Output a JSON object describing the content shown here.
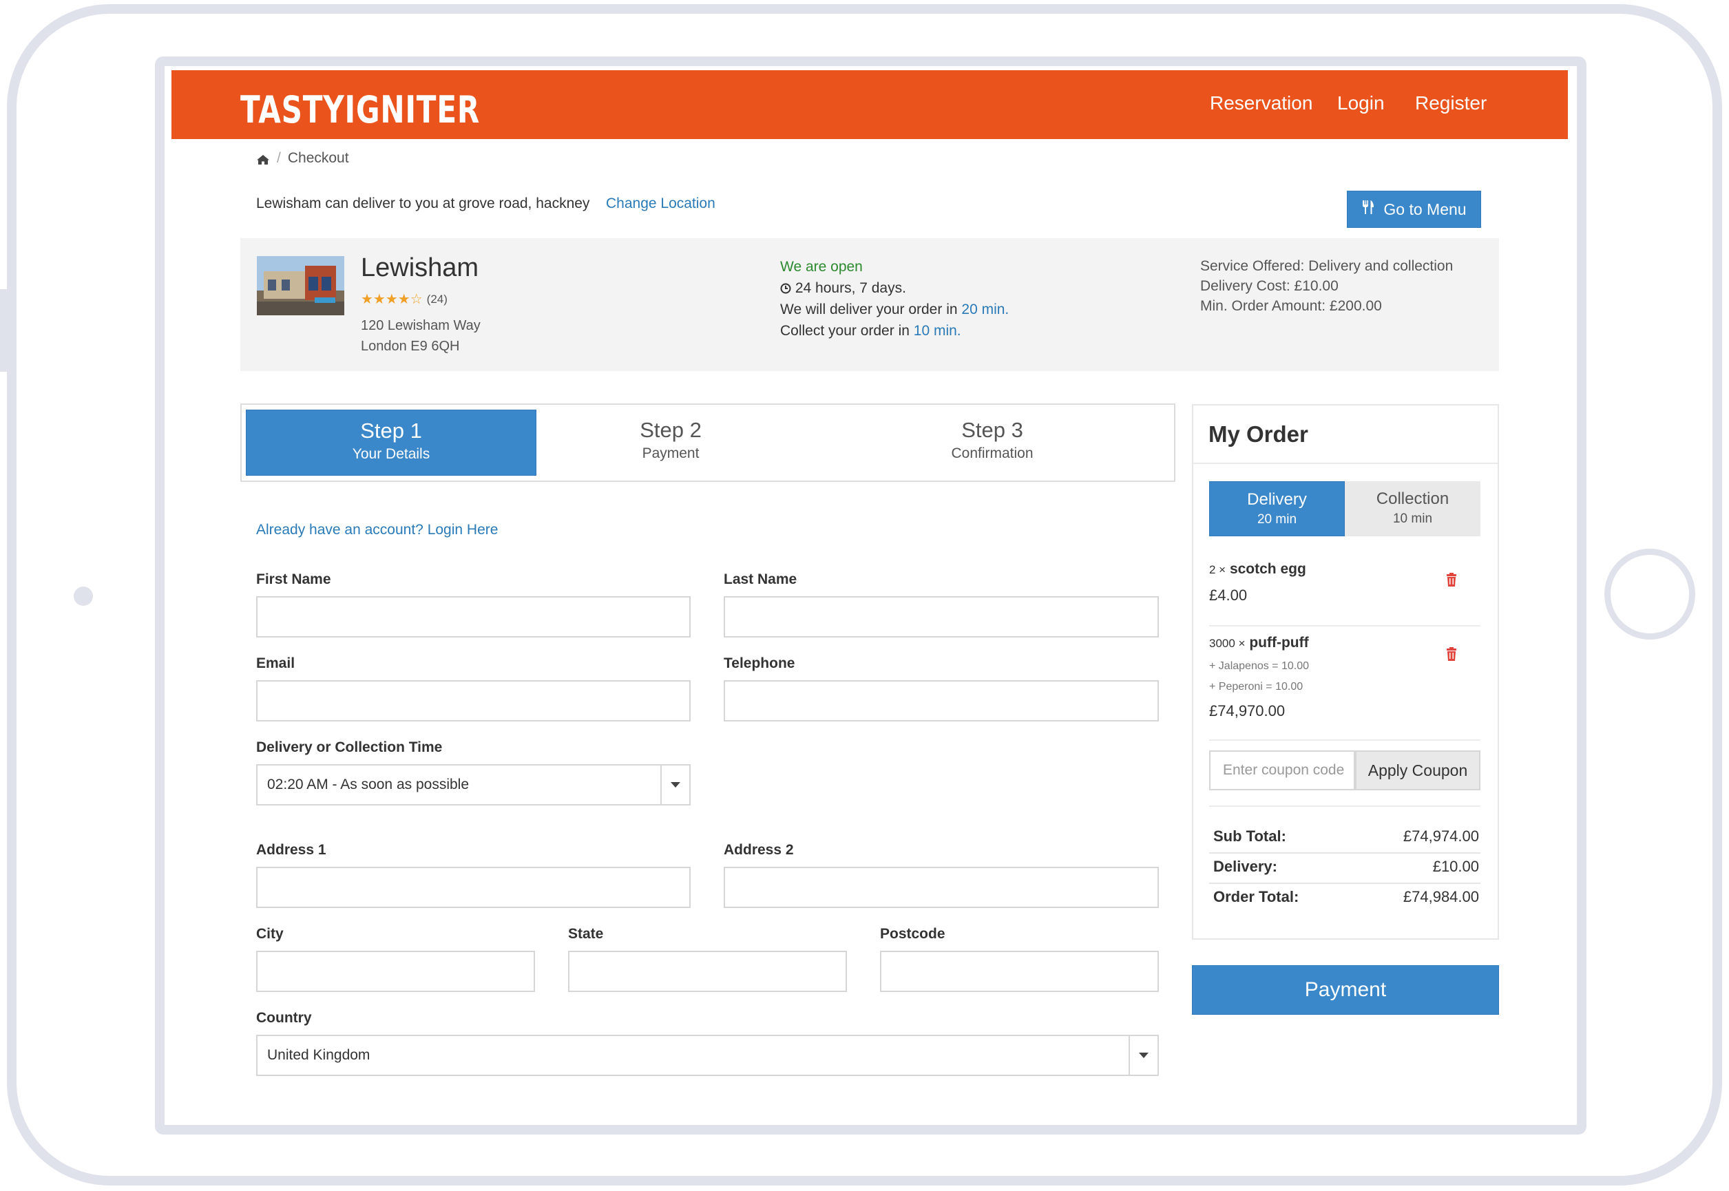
{
  "colors": {
    "brand": "#eb531c",
    "primary": "#3a87c9",
    "link": "#2a7ab8",
    "open": "#2c8a2f"
  },
  "header": {
    "logo": "TASTYIGNITER",
    "nav": {
      "reservation": "Reservation",
      "login": "Login",
      "register": "Register"
    }
  },
  "breadcrumb": {
    "home_icon": "home-icon",
    "current": "Checkout"
  },
  "location_bar": {
    "deliver_text": "Lewisham can deliver to you at grove road, hackney",
    "change_location": "Change Location",
    "go_to_menu": "Go to Menu"
  },
  "location": {
    "name": "Lewisham",
    "stars": "★★★★☆",
    "rating_value": 3.5,
    "reviews": "(24)",
    "address_line1": "120 Lewisham Way",
    "address_line2": "London E9 6QH",
    "status": "We are open",
    "hours": "24 hours, 7 days.",
    "delivery_prefix": "We will deliver your order in",
    "delivery_time": "20 min.",
    "collect_prefix": "Collect your order in",
    "collect_time": "10 min.",
    "service_offered": "Service Offered: Delivery and collection",
    "delivery_cost": "Delivery Cost: £10.00",
    "min_order": "Min. Order Amount: £200.00"
  },
  "steps": [
    {
      "title": "Step 1",
      "subtitle": "Your Details"
    },
    {
      "title": "Step 2",
      "subtitle": "Payment"
    },
    {
      "title": "Step 3",
      "subtitle": "Confirmation"
    }
  ],
  "form": {
    "account_prompt": "Already have an account?",
    "login_here": "Login Here",
    "first_name": {
      "label": "First Name",
      "value": ""
    },
    "last_name": {
      "label": "Last Name",
      "value": ""
    },
    "email": {
      "label": "Email",
      "value": ""
    },
    "telephone": {
      "label": "Telephone",
      "value": ""
    },
    "time": {
      "label": "Delivery or Collection Time",
      "value": "02:20 AM - As soon as possible"
    },
    "address1": {
      "label": "Address 1",
      "value": ""
    },
    "address2": {
      "label": "Address 2",
      "value": ""
    },
    "city": {
      "label": "City",
      "value": ""
    },
    "state": {
      "label": "State",
      "value": ""
    },
    "postcode": {
      "label": "Postcode",
      "value": ""
    },
    "country": {
      "label": "Country",
      "value": "United Kingdom"
    }
  },
  "order": {
    "title": "My Order",
    "tabs": [
      {
        "label": "Delivery",
        "time": "20 min"
      },
      {
        "label": "Collection",
        "time": "10 min"
      }
    ],
    "items": [
      {
        "qty": "2 ×",
        "name": "scotch egg",
        "options": [],
        "price": "£4.00"
      },
      {
        "qty": "3000 ×",
        "name": "puff-puff",
        "options": [
          "+ Jalapenos = 10.00",
          "+ Peperoni = 10.00"
        ],
        "price": "£74,970.00"
      }
    ],
    "coupon_placeholder": "Enter coupon code",
    "apply_coupon": "Apply Coupon",
    "totals": [
      {
        "label": "Sub Total:",
        "value": "£74,974.00"
      },
      {
        "label": "Delivery:",
        "value": "£10.00"
      },
      {
        "label": "Order Total:",
        "value": "£74,984.00"
      }
    ],
    "payment_button": "Payment"
  }
}
